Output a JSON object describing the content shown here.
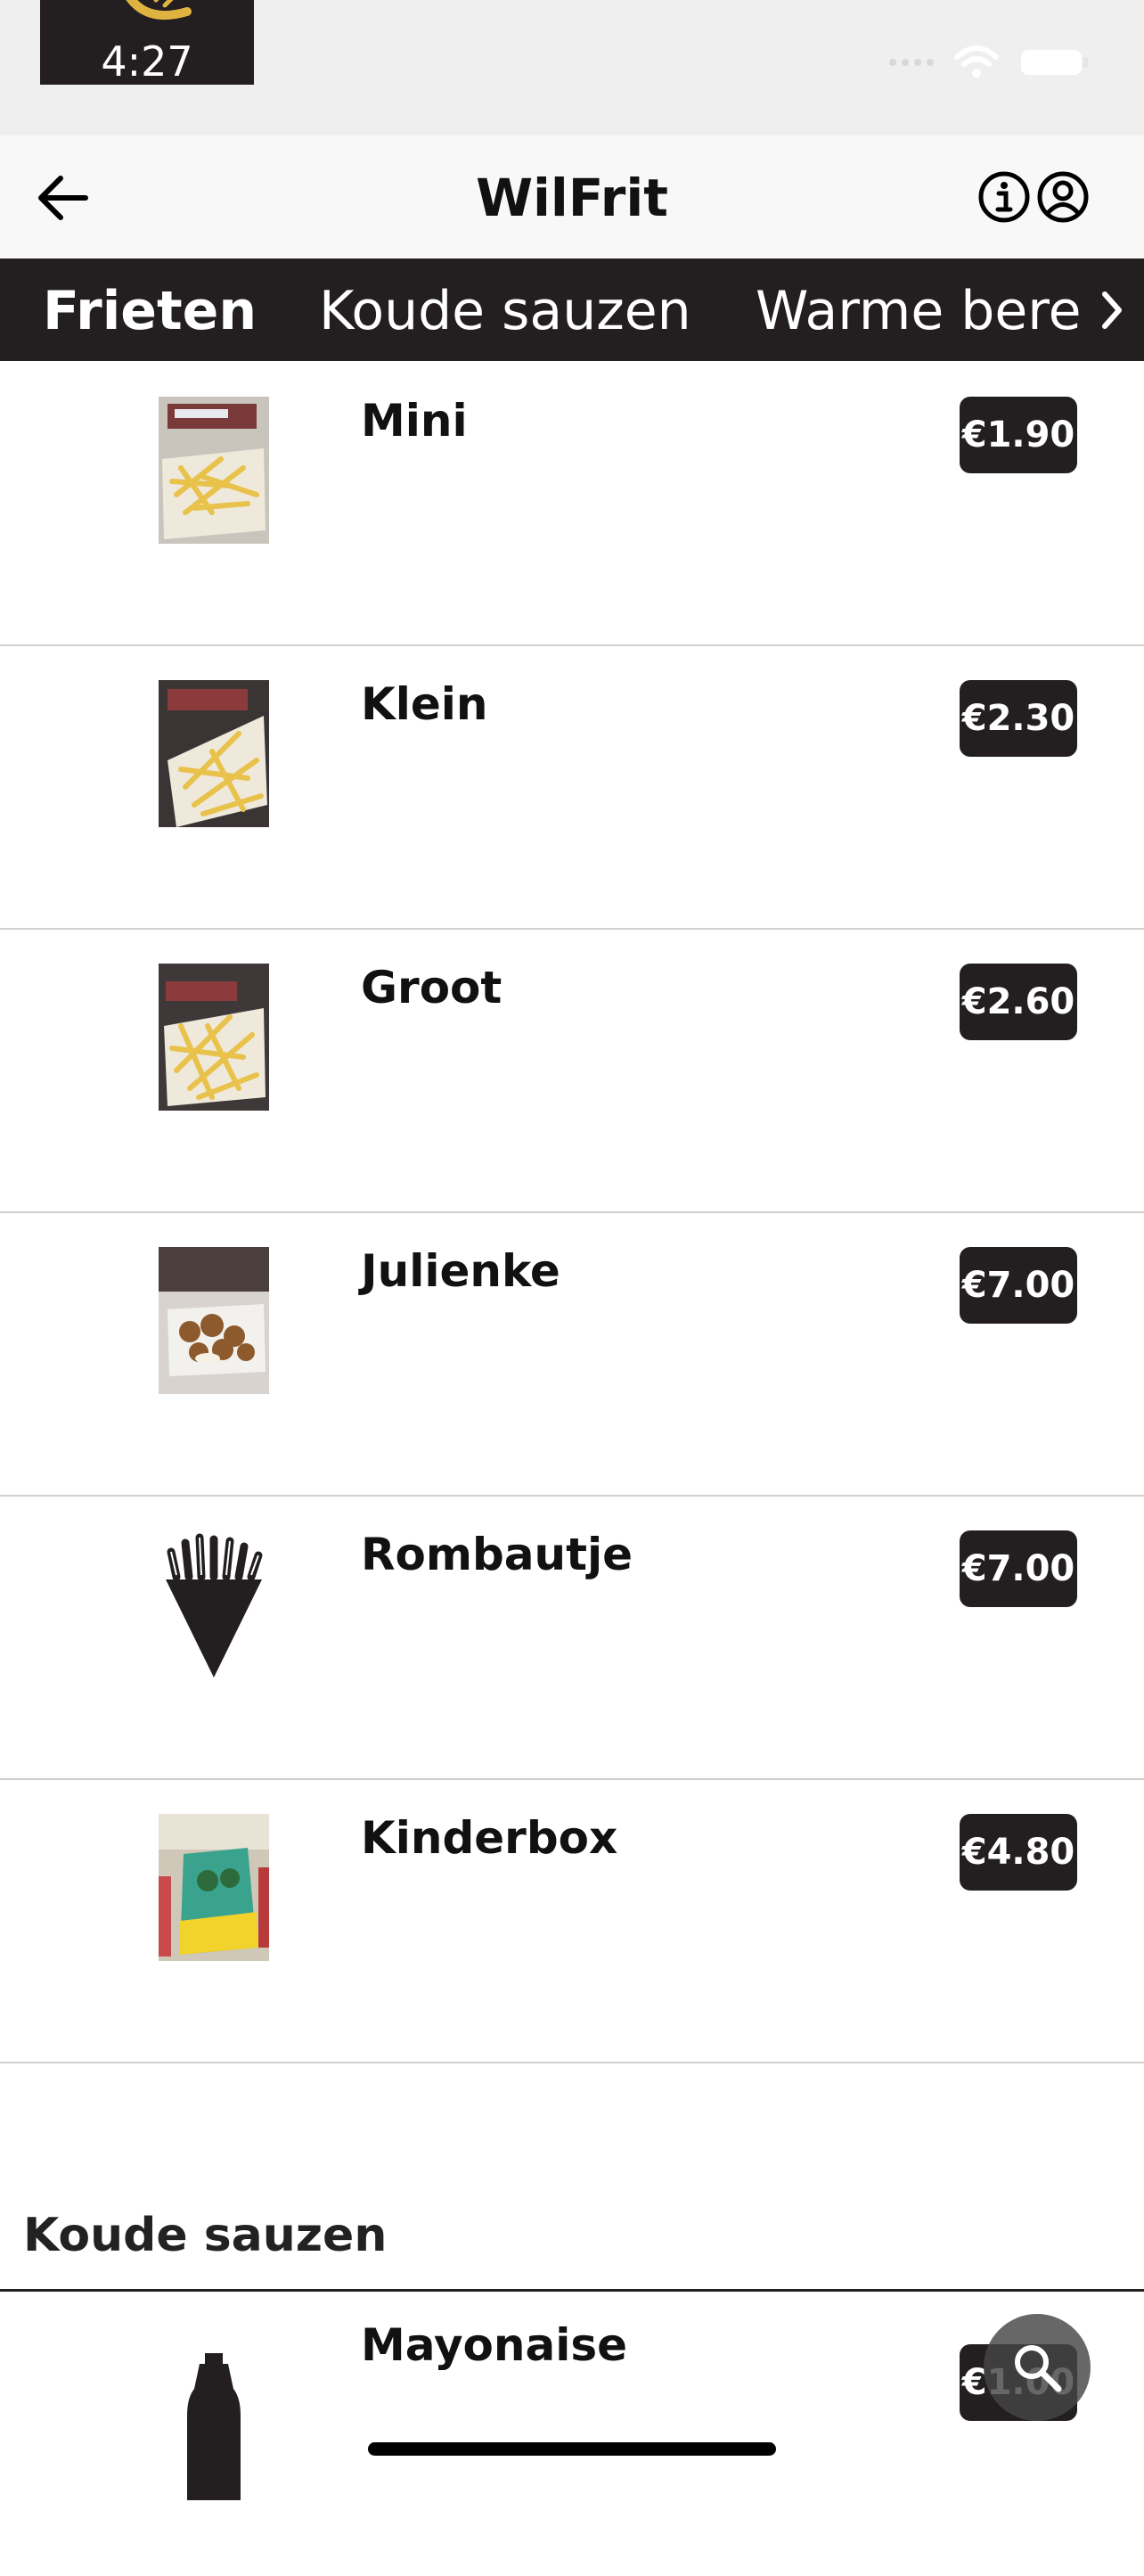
{
  "status_bar": {
    "time": "4:27"
  },
  "header": {
    "title": "WilFrit"
  },
  "tabs": [
    {
      "label": "Frieten",
      "active": true
    },
    {
      "label": "Koude sauzen",
      "active": false
    },
    {
      "label": "Warme bere",
      "active": false
    }
  ],
  "products": [
    {
      "name": "Mini",
      "price": "€1.90",
      "image": "fries-photo"
    },
    {
      "name": "Klein",
      "price": "€2.30",
      "image": "fries-photo"
    },
    {
      "name": "Groot",
      "price": "€2.60",
      "image": "fries-photo"
    },
    {
      "name": "Julienke",
      "price": "€7.00",
      "image": "snack-tray-photo"
    },
    {
      "name": "Rombautje",
      "price": "€7.00",
      "image": "fries-cone-icon"
    },
    {
      "name": "Kinderbox",
      "price": "€4.80",
      "image": "kids-box-photo"
    },
    {
      "name": "Mayonaise",
      "price": "€1.00",
      "image": "sauce-bottle-icon"
    }
  ],
  "sections": [
    {
      "heading": "Koude sauzen"
    }
  ],
  "colors": {
    "dark": "#231f20",
    "header_bg": "#f8f8f8",
    "statusbar_bg": "#efefef",
    "fries_yellow": "#e8c24a"
  }
}
